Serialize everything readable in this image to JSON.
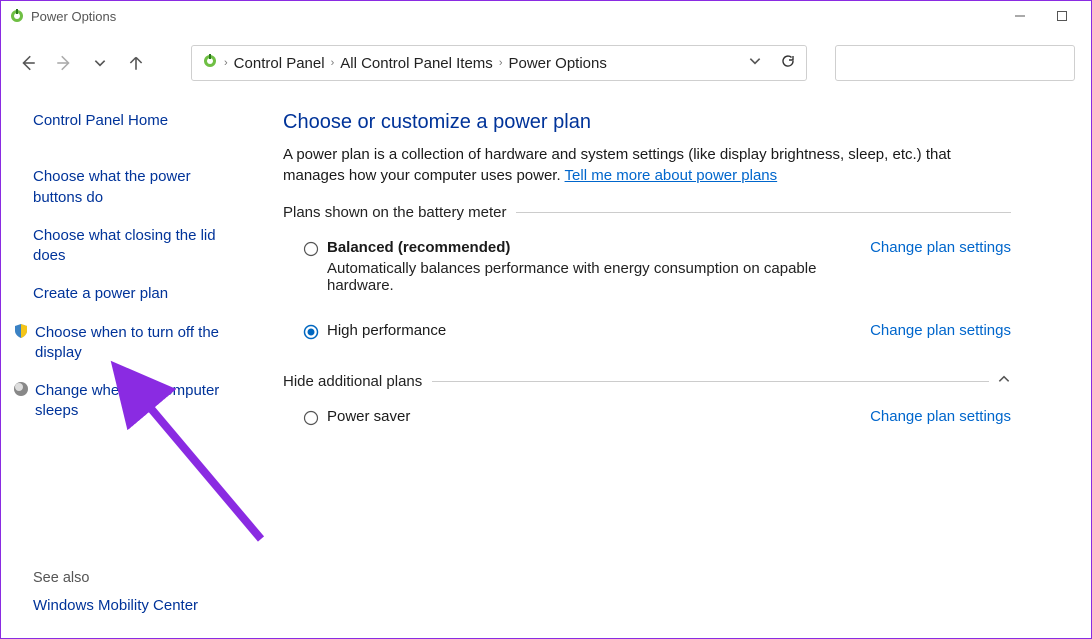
{
  "titlebar": {
    "title": "Power Options"
  },
  "breadcrumbs": {
    "a": "Control Panel",
    "b": "All Control Panel Items",
    "c": "Power Options"
  },
  "sidebar": {
    "home": "Control Panel Home",
    "link1": "Choose what the power buttons do",
    "link2": "Choose what closing the lid does",
    "link3": "Create a power plan",
    "link4": "Choose when to turn off the display",
    "link5": "Change when the computer sleeps",
    "see_also": "See also",
    "mobility": "Windows Mobility Center"
  },
  "main": {
    "heading": "Choose or customize a power plan",
    "desc_a": "A power plan is a collection of hardware and system settings (like display brightness, sleep, etc.) that manages how your computer uses power. ",
    "desc_link": "Tell me more about power plans",
    "section1": "Plans shown on the battery meter",
    "section2": "Hide additional plans",
    "change": "Change plan settings",
    "plan1": {
      "name": "Balanced (recommended)",
      "desc": "Automatically balances performance with energy consumption on capable hardware."
    },
    "plan2": {
      "name": "High performance"
    },
    "plan3": {
      "name": "Power saver"
    }
  }
}
